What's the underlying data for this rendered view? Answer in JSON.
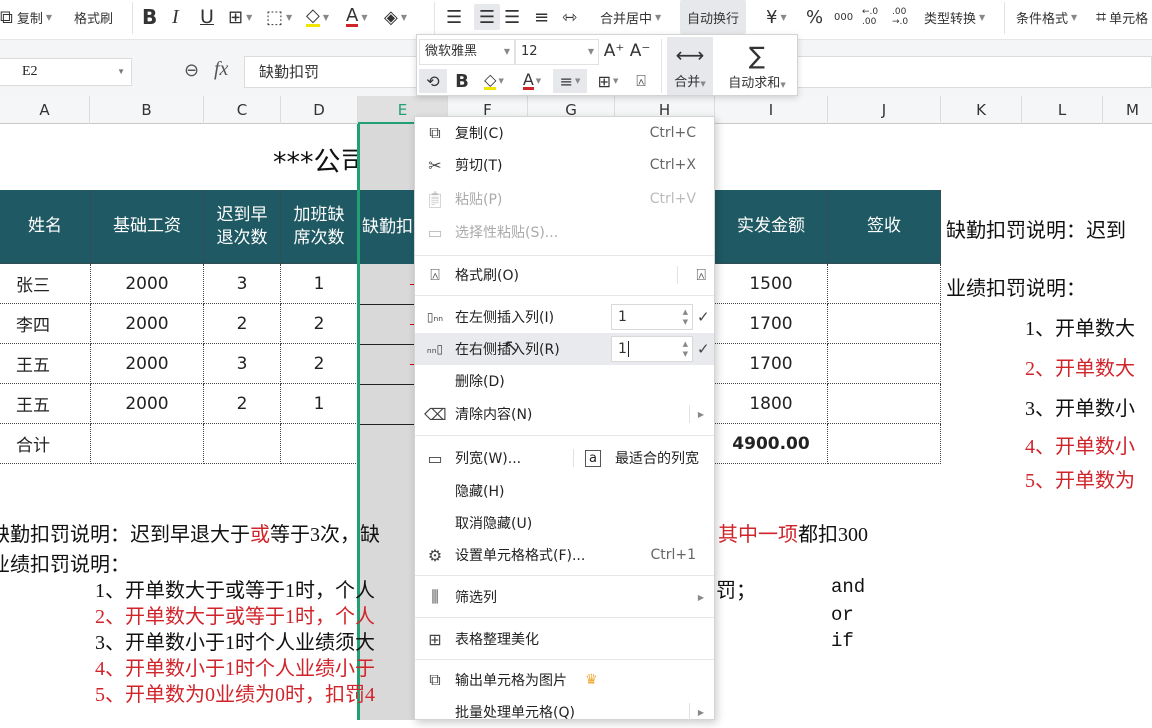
{
  "ribbon": {
    "copy_label": "复制",
    "format_painter_label": "格式刷",
    "merge_center_label": "合并居中",
    "wrap_text_label": "自动换行",
    "currency_symbol": "¥",
    "percent_symbol": "%",
    "thousands_symbol": "000",
    "dec_inc_symbol": "←.0 .00",
    "dec_dec_symbol": ".00 →.0",
    "type_convert_label": "类型转换",
    "cond_format_label": "条件格式",
    "cell_style_label": "单元格"
  },
  "formula_bar": {
    "name_box": "E2",
    "fx_label": "fx",
    "formula": "缺勤扣罚"
  },
  "columns": [
    "A",
    "B",
    "C",
    "D",
    "E",
    "F",
    "G",
    "H",
    "I",
    "J",
    "K",
    "L",
    "M"
  ],
  "sheet": {
    "title": "***公司业绩",
    "headers": {
      "name": "姓名",
      "base_salary": "基础工资",
      "late_line1": "迟到早",
      "late_line2": "退次数",
      "absent_line1": "加班缺",
      "absent_line2": "席次数",
      "deduction": "缺勤扣",
      "actual": "实发金额",
      "sign": "签收"
    },
    "rows": [
      {
        "name": "张三",
        "base": "2000",
        "late": "3",
        "absent": "1",
        "actual": "1500",
        "sign": ""
      },
      {
        "name": "李四",
        "base": "2000",
        "late": "2",
        "absent": "2",
        "actual": "1700",
        "sign": ""
      },
      {
        "name": "王五",
        "base": "2000",
        "late": "3",
        "absent": "2",
        "actual": "1700",
        "sign": ""
      },
      {
        "name": "王五",
        "base": "2000",
        "late": "2",
        "absent": "1",
        "actual": "1800",
        "sign": ""
      }
    ],
    "total": {
      "label": "合计",
      "actual": "4900.00"
    },
    "notes_right": {
      "absence": "缺勤扣罚说明：迟到",
      "performance": "业绩扣罚说明：",
      "items": [
        "1、开单数大",
        "2、开单数大",
        "3、开单数小",
        "4、开单数小",
        "5、开单数为"
      ]
    },
    "notes_bottom": {
      "absence_a": "缺勤扣罚说明：迟到早退大于",
      "absence_b": "或",
      "absence_c": "等于3次，缺",
      "absence_tail_red": "其中一项",
      "absence_tail": "都扣300",
      "performance": "业绩扣罚说明：",
      "items": [
        "1、开单数大于或等于1时，个人",
        "2、开单数大于或等于1时，个人",
        "3、开单数小于1时个人业绩须大",
        "4、开单数小于1时个人业绩小于",
        "5、开单数为0业绩为0时，扣罚4"
      ],
      "item1_tail": "罚；",
      "keywords": [
        "and",
        "or",
        "if"
      ]
    }
  },
  "mini_toolbar": {
    "font_name": "微软雅黑",
    "font_size": "12",
    "merge_label": "合并",
    "autosum_label": "自动求和"
  },
  "context_menu": {
    "items": [
      {
        "label": "复制(C)",
        "shortcut": "Ctrl+C"
      },
      {
        "label": "剪切(T)",
        "shortcut": "Ctrl+X"
      },
      {
        "label": "粘贴(P)",
        "shortcut": "Ctrl+V"
      },
      {
        "label": "选择性粘贴(S)..."
      },
      {
        "label": "格式刷(O)"
      },
      {
        "label": "在左侧插入列(I)",
        "value": "1"
      },
      {
        "label": "在右侧插入列(R)",
        "value": "1"
      },
      {
        "label": "删除(D)"
      },
      {
        "label": "清除内容(N)"
      },
      {
        "label": "列宽(W)...",
        "extra": "最适合的列宽"
      },
      {
        "label": "隐藏(H)"
      },
      {
        "label": "取消隐藏(U)"
      },
      {
        "label": "设置单元格格式(F)...",
        "shortcut": "Ctrl+1"
      },
      {
        "label": "筛选列"
      },
      {
        "label": "表格整理美化"
      },
      {
        "label": "输出单元格为图片"
      },
      {
        "label": "批量处理单元格(Q)"
      }
    ]
  },
  "colors": {
    "header_fill": "#1f5963",
    "selection_green": "#22a074",
    "red_text": "#d0242b"
  }
}
